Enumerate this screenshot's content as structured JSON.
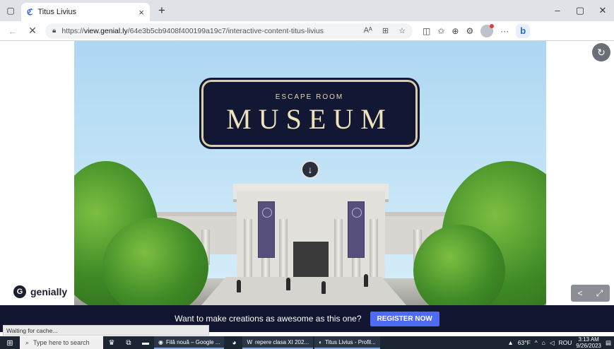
{
  "browser": {
    "tab_title": "Titus Livius",
    "tab_close": "×",
    "new_tab": "+",
    "url_prefix": "https://",
    "url_domain": "view.genial.ly",
    "url_path": "/64e3b5cb9408f400199a19c7/interactive-content-titus-livius",
    "win_min": "–",
    "win_max": "▢",
    "win_close": "✕"
  },
  "scene": {
    "sign_subtitle": "ESCAPE ROOM",
    "sign_title": "MUSEUM",
    "down_icon": "↓",
    "brand": "genially",
    "brand_icon": "G"
  },
  "promo": {
    "text": "Want to make creations as awesome as this one?",
    "button": "REGISTER NOW"
  },
  "status_message": "Waiting for cache...",
  "taskbar": {
    "search_placeholder": "Type here to search",
    "apps": [
      {
        "label": "Filă nouă – Google ..."
      },
      {
        "label": "repere clasa XI 202..."
      },
      {
        "label": "Titus Livius - Profil..."
      }
    ],
    "weather": "63°F",
    "language": "ROU",
    "time": "3:13 AM",
    "date": "9/26/2023"
  }
}
